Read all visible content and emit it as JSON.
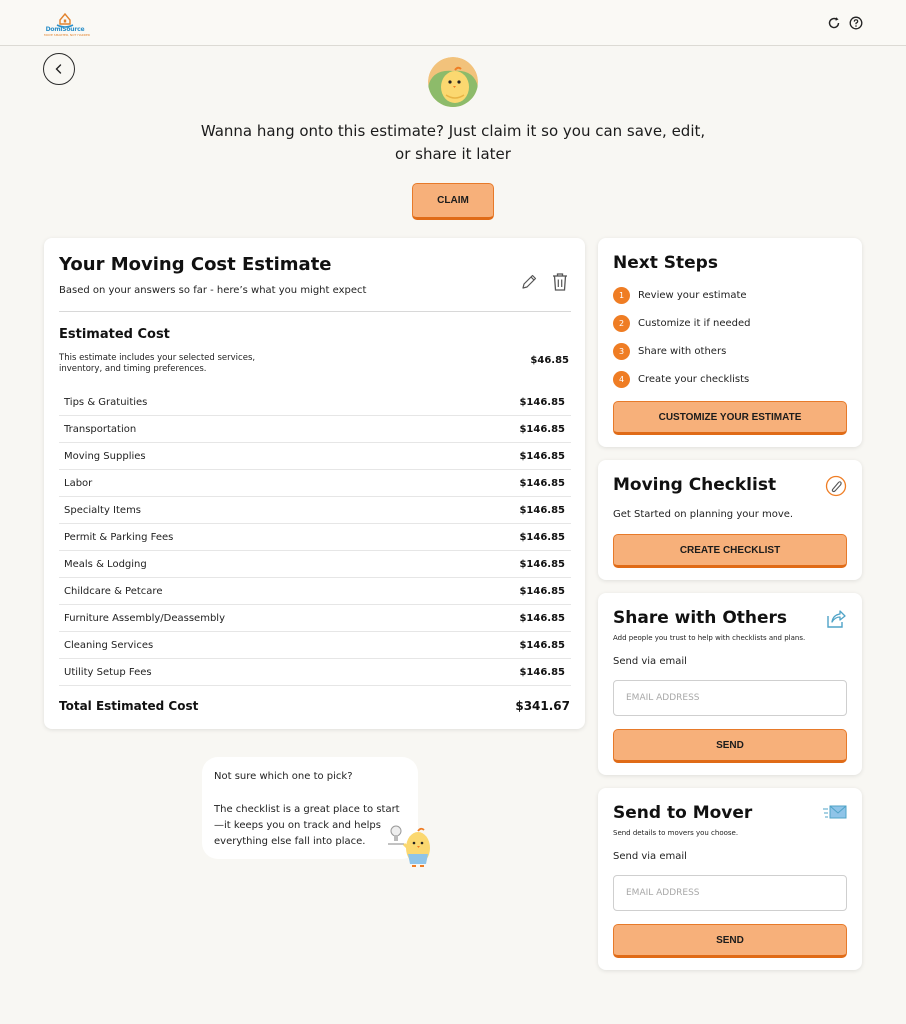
{
  "brand": {
    "name": "DomiSource",
    "tagline": "MOVE SMARTER, NOT HARDER"
  },
  "topbar": {
    "refresh_icon": "refresh-icon",
    "help_icon": "help-icon"
  },
  "claim": {
    "message": "Wanna hang onto this estimate? Just claim it so you can save, edit, or share it later",
    "button_label": "CLAIM"
  },
  "estimate": {
    "title": "Your Moving Cost Estimate",
    "subtitle": "Based on your answers so far - here’s what you might expect",
    "estimated_cost_label": "Estimated Cost",
    "estimated_cost_desc": "This estimate includes your selected services, inventory, and timing preferences.",
    "estimated_cost_value": "$46.85",
    "items": [
      {
        "label": "Tips & Gratuities",
        "value": "$146.85"
      },
      {
        "label": "Transportation",
        "value": "$146.85"
      },
      {
        "label": "Moving Supplies",
        "value": "$146.85"
      },
      {
        "label": "Labor",
        "value": "$146.85"
      },
      {
        "label": "Specialty Items",
        "value": "$146.85"
      },
      {
        "label": "Permit & Parking Fees",
        "value": "$146.85"
      },
      {
        "label": "Meals & Lodging",
        "value": "$146.85"
      },
      {
        "label": "Childcare & Petcare",
        "value": "$146.85"
      },
      {
        "label": "Furniture Assembly/Deassembly",
        "value": "$146.85"
      },
      {
        "label": "Cleaning Services",
        "value": "$146.85"
      },
      {
        "label": "Utility Setup Fees",
        "value": "$146.85"
      }
    ],
    "total_label": "Total Estimated Cost",
    "total_value": "$341.67"
  },
  "tip_bubble": {
    "question": "Not sure which one to pick?",
    "text": "The checklist is a great place to start—it keeps you on track and helps everything else fall into place."
  },
  "next_steps": {
    "title": "Next Steps",
    "steps": [
      {
        "num": "1",
        "label": "Review your estimate"
      },
      {
        "num": "2",
        "label": "Customize it if needed"
      },
      {
        "num": "3",
        "label": "Share with others"
      },
      {
        "num": "4",
        "label": "Create your checklists"
      }
    ],
    "button_label": "CUSTOMIZE YOUR ESTIMATE"
  },
  "checklist": {
    "title": "Moving Checklist",
    "text": "Get Started on planning your move.",
    "button_label": "CREATE CHECKLIST"
  },
  "share": {
    "title": "Share with Others",
    "subtitle": "Add people you trust to help with checklists and plans.",
    "via_label": "Send via email",
    "email_placeholder": "EMAIL ADDRESS",
    "button_label": "SEND"
  },
  "mover": {
    "title": "Send to Mover",
    "subtitle": "Send details to movers you choose.",
    "via_label": "Send via email",
    "email_placeholder": "EMAIL ADDRESS",
    "button_label": "SEND"
  },
  "colors": {
    "accent": "#f7b07a",
    "accent_border": "#e06b17",
    "step_badge": "#ef7d24",
    "background": "#f8f7f3"
  }
}
